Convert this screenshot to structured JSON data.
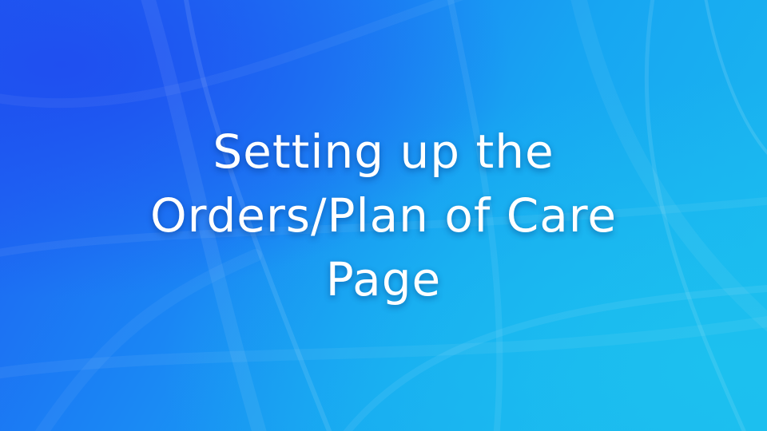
{
  "slide": {
    "title_lines": [
      "Setting up the",
      "Orders/Plan of Care",
      "Page"
    ]
  },
  "colors": {
    "background_dark": "#1e5cf2",
    "background_light": "#1bbcee",
    "title_text": "#ffffff"
  }
}
